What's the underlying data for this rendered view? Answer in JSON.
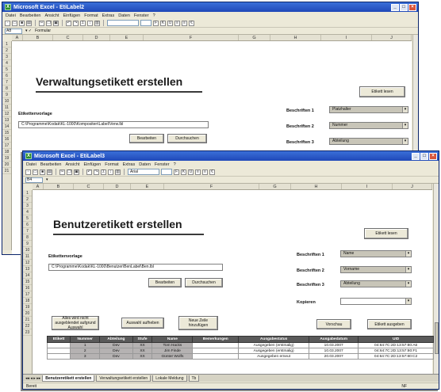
{
  "window1": {
    "title": "Microsoft Excel - EtiLabel2",
    "menu": [
      "Datei",
      "Bearbeiten",
      "Ansicht",
      "Einfügen",
      "Format",
      "Extras",
      "Daten",
      "Fenster",
      "?"
    ],
    "namebox": "A8",
    "formula_label": "Formular",
    "columns": [
      "A",
      "B",
      "C",
      "D",
      "E",
      "F",
      "G",
      "H",
      "I",
      "J"
    ],
    "rows": [
      "1",
      "2",
      "3",
      "4",
      "5",
      "6",
      "7",
      "8",
      "9",
      "10",
      "11",
      "12",
      "13",
      "14",
      "15",
      "16",
      "17",
      "18",
      "19",
      "20",
      "21"
    ],
    "heading": "Verwaltungsetikett erstellen",
    "template_label": "Etikettenvorlage",
    "template_path": "C:\\Programme\\Kodak\\KL-1000\\Kompositen\\Label\\Verw.lbl",
    "edit_button": "Bearbeiten",
    "browse_button": "Durchsuchen",
    "print_button": "Etikett lesen",
    "field_labels": [
      "Beschriften 1",
      "Beschriften 2",
      "Beschriften 3"
    ],
    "field_values": [
      "Platzhalter",
      "Nummer",
      "Abteilung"
    ]
  },
  "window2": {
    "title": "Microsoft Excel - EtiLabel3",
    "menu": [
      "Datei",
      "Bearbeiten",
      "Ansicht",
      "Einfügen",
      "Format",
      "Extras",
      "Daten",
      "Fenster",
      "?"
    ],
    "namebox": "B4",
    "font_name": "Arial",
    "columns": [
      "A",
      "B",
      "C",
      "D",
      "E",
      "F",
      "G",
      "H",
      "I",
      "J"
    ],
    "rows": [
      "1",
      "2",
      "3",
      "4",
      "5",
      "6",
      "7",
      "8",
      "9",
      "10",
      "11",
      "12",
      "13",
      "14",
      "15",
      "16",
      "17",
      "18",
      "19",
      "20",
      "21",
      "22",
      "23"
    ],
    "heading": "Benutzeretikett erstellen",
    "template_label": "Etikettenvorlage",
    "template_path": "C:\\Programme\\Kodak\\KL-1000\\Benutzer\\BenLabel\\Ben.lbl",
    "edit_button": "Bearbeiten",
    "browse_button": "Durchsuchen",
    "print_button": "Etikett lesen",
    "field_labels": [
      "Beschriften 1",
      "Beschriften 2",
      "Beschriften 3",
      "Kopieren"
    ],
    "field_values": [
      "Name",
      "Vorname",
      "Abteilung",
      ""
    ],
    "action_buttons": [
      "Alles wird nicht ausgeblendet aufgrund Auswahl",
      "Auswahl aufheben",
      "Neue Zeile hinzufügen"
    ],
    "right_buttons": [
      "Vorschau",
      "Etikett ausgeben"
    ],
    "table": {
      "headers": [
        "Etikett",
        "Nummer",
        "Abteilung",
        "Stufe",
        "Name",
        "Bemerkungen",
        "Ausgabestatus",
        "Ausgabedatum",
        "UID"
      ],
      "rows": [
        [
          "",
          "1",
          "Dev",
          "XX",
          "Tom Hacks",
          "",
          "Ausgegeben (erstmalig)",
          "10.03.2007",
          "04:64:7C:2D:13:57:80:A6"
        ],
        [
          "",
          "2",
          "Dev",
          "XX",
          "Jim Finde",
          "",
          "Ausgegeben (erstmalig)",
          "10.03.2007",
          "04:64:7C:2D:13:57:80:F1"
        ],
        [
          "",
          "3",
          "Dev",
          "XX",
          "Günter Wolfs",
          "",
          "Ausgegeben erneut",
          "20.03.2007",
          "04:64:7C:2D:13:57:80:C2"
        ]
      ]
    },
    "sheet_tabs": [
      "Benutzeretikett erstellen",
      "Verwaltungsetikett erstellen",
      "Lokale Meldung",
      "Tb"
    ],
    "status": "Bereit",
    "status_right": "NF"
  }
}
